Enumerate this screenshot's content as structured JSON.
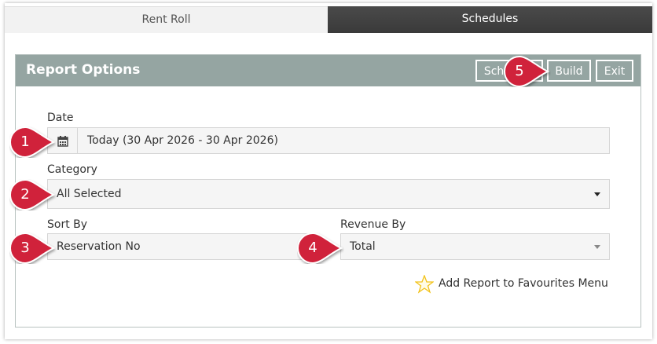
{
  "tabs": {
    "left": "Rent Roll",
    "right": "Schedules"
  },
  "panel": {
    "title": "Report Options",
    "buttons": {
      "schedule": "Schedule",
      "build": "Build",
      "exit": "Exit"
    }
  },
  "form": {
    "date_label": "Date",
    "date_value": "Today (30 Apr 2026 - 30 Apr 2026)",
    "category_label": "Category",
    "category_value": "All Selected",
    "sortby_label": "Sort By",
    "sortby_value": "Reservation No",
    "revenue_label": "Revenue By",
    "revenue_value": "Total",
    "favourites": "Add Report to Favourites Menu"
  },
  "markers": [
    "1",
    "2",
    "3",
    "4",
    "5"
  ],
  "colors": {
    "marker": "#d0203a",
    "header": "#95a5a2",
    "active_tab": "#444444",
    "star": "#f2c21a"
  },
  "icons": {
    "calendar": "calendar-icon",
    "star": "star-icon",
    "caret": "caret-down-icon"
  }
}
